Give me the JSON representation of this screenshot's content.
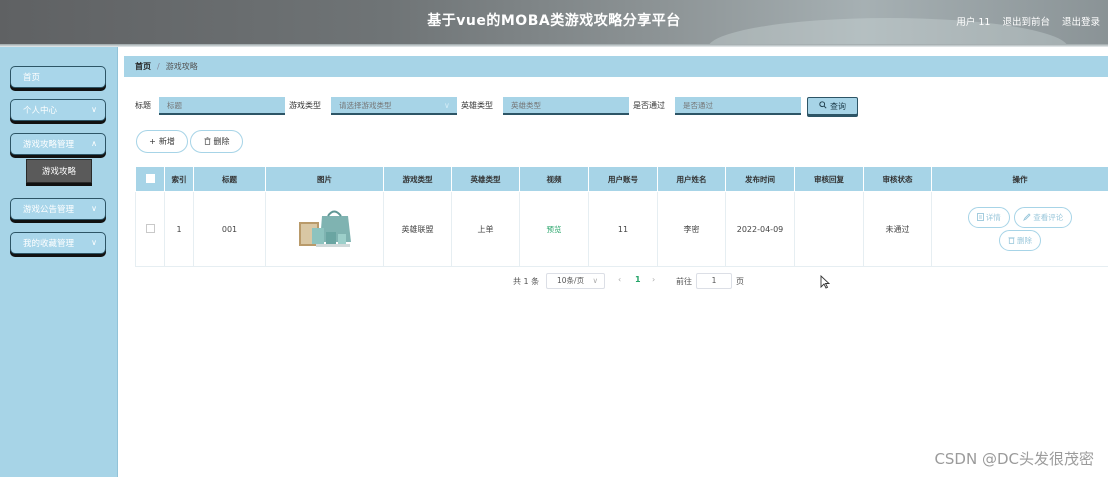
{
  "header": {
    "title": "基于vue的MOBA类游戏攻略分享平台",
    "user_label": "用户 11",
    "back_label": "退出到前台",
    "logout_label": "退出登录"
  },
  "sidebar": {
    "items": [
      {
        "label": "首页",
        "has_chevron": false
      },
      {
        "label": "个人中心",
        "has_chevron": true
      },
      {
        "label": "游戏攻略管理",
        "has_chevron": true
      },
      {
        "label": "游戏公告管理",
        "has_chevron": true
      },
      {
        "label": "我的收藏管理",
        "has_chevron": true
      }
    ],
    "active_sub": "游戏攻略"
  },
  "breadcrumb": {
    "home": "首页",
    "separator": "/",
    "current": "游戏攻略"
  },
  "search": {
    "title_label": "标题",
    "title_placeholder": "标题",
    "game_type_label": "游戏类型",
    "game_type_placeholder": "请选择游戏类型",
    "hero_type_label": "英雄类型",
    "hero_type_placeholder": "英雄类型",
    "passed_label": "是否通过",
    "passed_placeholder": "是否通过",
    "query_label": "查询"
  },
  "actions": {
    "add_label": "新增",
    "delete_label": "删除"
  },
  "table": {
    "headers": [
      "索引",
      "标题",
      "图片",
      "游戏类型",
      "英雄类型",
      "视频",
      "用户账号",
      "用户姓名",
      "发布时间",
      "审核回复",
      "审核状态",
      "操作"
    ],
    "rows": [
      {
        "index": "1",
        "title": "001",
        "game_type": "英雄联盟",
        "hero_type": "上单",
        "video": "预览",
        "account": "11",
        "name": "李密",
        "time": "2022-04-09",
        "reply": "",
        "status": "未通过",
        "ops": {
          "detail": "详情",
          "comments": "查看评论",
          "delete": "删除"
        }
      }
    ]
  },
  "pagination": {
    "total": "共 1 条",
    "page_size": "10条/页",
    "current": "1",
    "goto_label": "前往",
    "goto_value": "1",
    "page_unit": "页"
  },
  "watermark": "CSDN @DC头发很茂密",
  "colors": {
    "accent": "#a7d4e7",
    "dark_border": "#2d5566",
    "preview_green": "#27a56a"
  }
}
